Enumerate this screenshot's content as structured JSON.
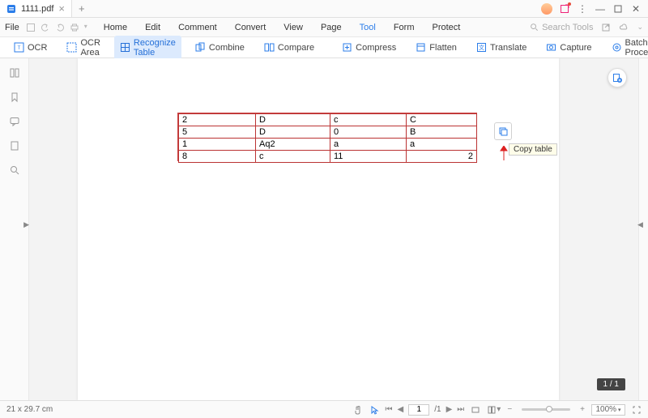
{
  "app": {
    "tab_title": "1111.pdf"
  },
  "menus": {
    "file": "File",
    "items": [
      "Home",
      "Edit",
      "Comment",
      "Convert",
      "View",
      "Page",
      "Tool",
      "Form",
      "Protect"
    ],
    "active_index": 6,
    "search_placeholder": "Search Tools"
  },
  "toolbar": {
    "ocr": "OCR",
    "ocr_area": "OCR Area",
    "recognize_table": "Recognize Table",
    "combine": "Combine",
    "compare": "Compare",
    "compress": "Compress",
    "flatten": "Flatten",
    "translate": "Translate",
    "capture": "Capture",
    "batch": "Batch Process"
  },
  "table": {
    "rows": [
      [
        "2",
        "D",
        "c",
        "C"
      ],
      [
        "5",
        "D",
        "0",
        "B"
      ],
      [
        "1",
        "Aq2",
        "a",
        "a"
      ],
      [
        "8",
        "c",
        "11",
        "2"
      ]
    ]
  },
  "tooltip": {
    "copy_table": "Copy table"
  },
  "status": {
    "dims": "21 x 29.7 cm",
    "page_current": "1",
    "page_total": "/1",
    "zoom": "100%"
  },
  "page_badge": "1 / 1"
}
